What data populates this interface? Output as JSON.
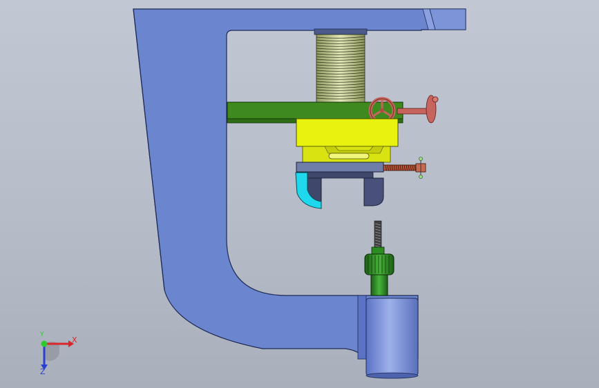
{
  "viewport": {
    "background": "#b9bfcb"
  },
  "model": {
    "parts": [
      {
        "name": "c-frame",
        "color": "#6b85cf"
      },
      {
        "name": "threaded-spindle",
        "color": "#b9c08a"
      },
      {
        "name": "crossbar-plate",
        "color": "#3f8a1f"
      },
      {
        "name": "handwheel",
        "color": "#c8645e"
      },
      {
        "name": "clamp-block",
        "color": "#e8f20f"
      },
      {
        "name": "guide-holder",
        "color": "#6f7ea8"
      },
      {
        "name": "cyan-jaw",
        "color": "#1fd8ee"
      },
      {
        "name": "adjust-screw",
        "color": "#b5553c"
      },
      {
        "name": "green-chuck",
        "color": "#2b8a22"
      },
      {
        "name": "base-cylinder",
        "color": "#6f88d6"
      }
    ]
  },
  "triad": {
    "x_label": "X",
    "y_label": "Y",
    "z_label": "Z",
    "x_color": "#d8262b",
    "y_color": "#2bcc2b",
    "z_color": "#2a3fd1"
  }
}
